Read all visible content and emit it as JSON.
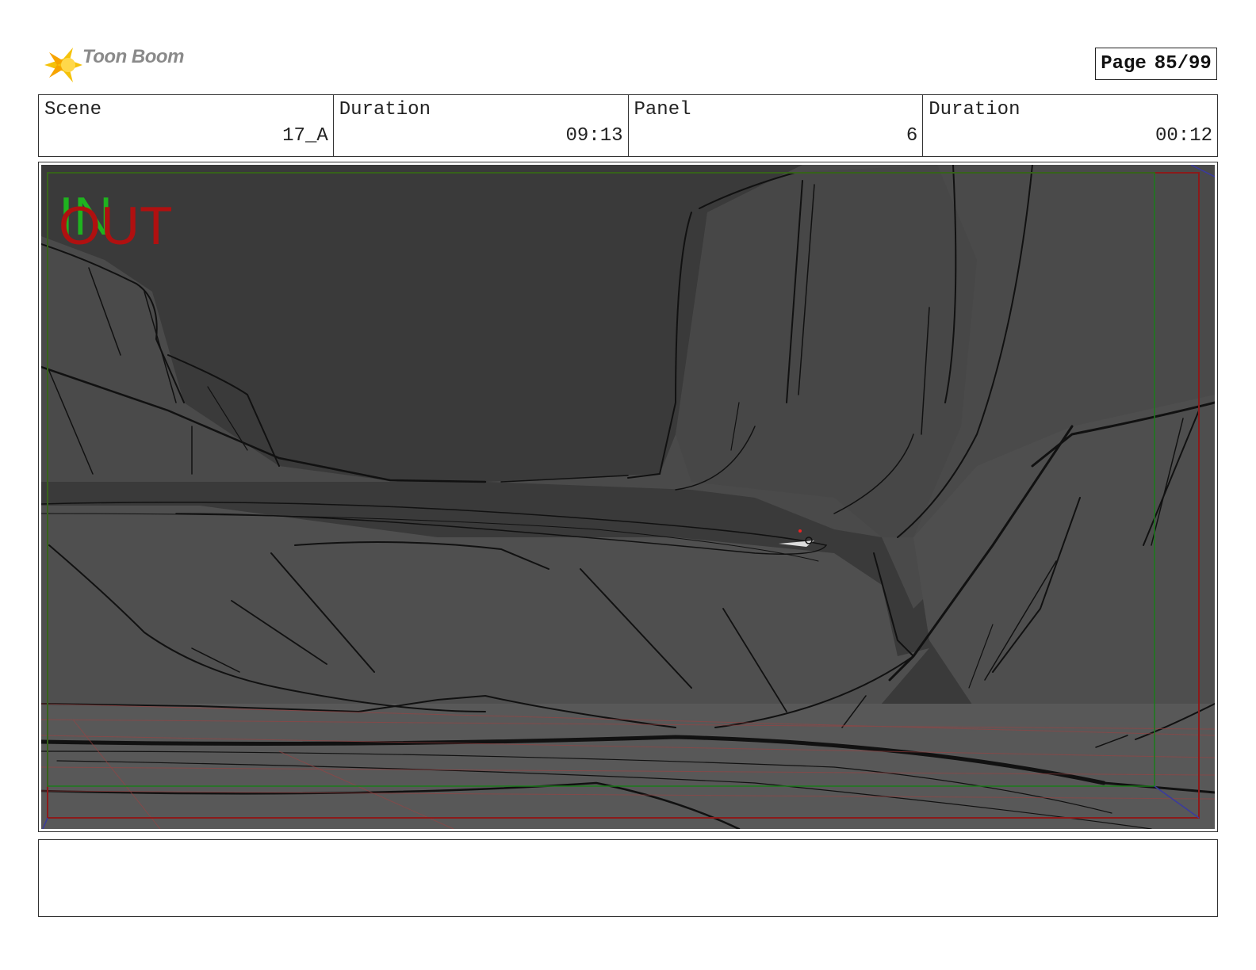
{
  "header": {
    "logo_text": "Toon Boom",
    "page_label": "Page",
    "page_number": "85/99"
  },
  "info": {
    "scene_label": "Scene",
    "scene_value": "17_A",
    "scene_duration_label": "Duration",
    "scene_duration_value": "09:13",
    "panel_label": "Panel",
    "panel_value": "6",
    "panel_duration_label": "Duration",
    "panel_duration_value": "00:12"
  },
  "panel_image": {
    "in_marker": "IN",
    "out_marker": "OUT"
  },
  "notes": {
    "text": ""
  }
}
